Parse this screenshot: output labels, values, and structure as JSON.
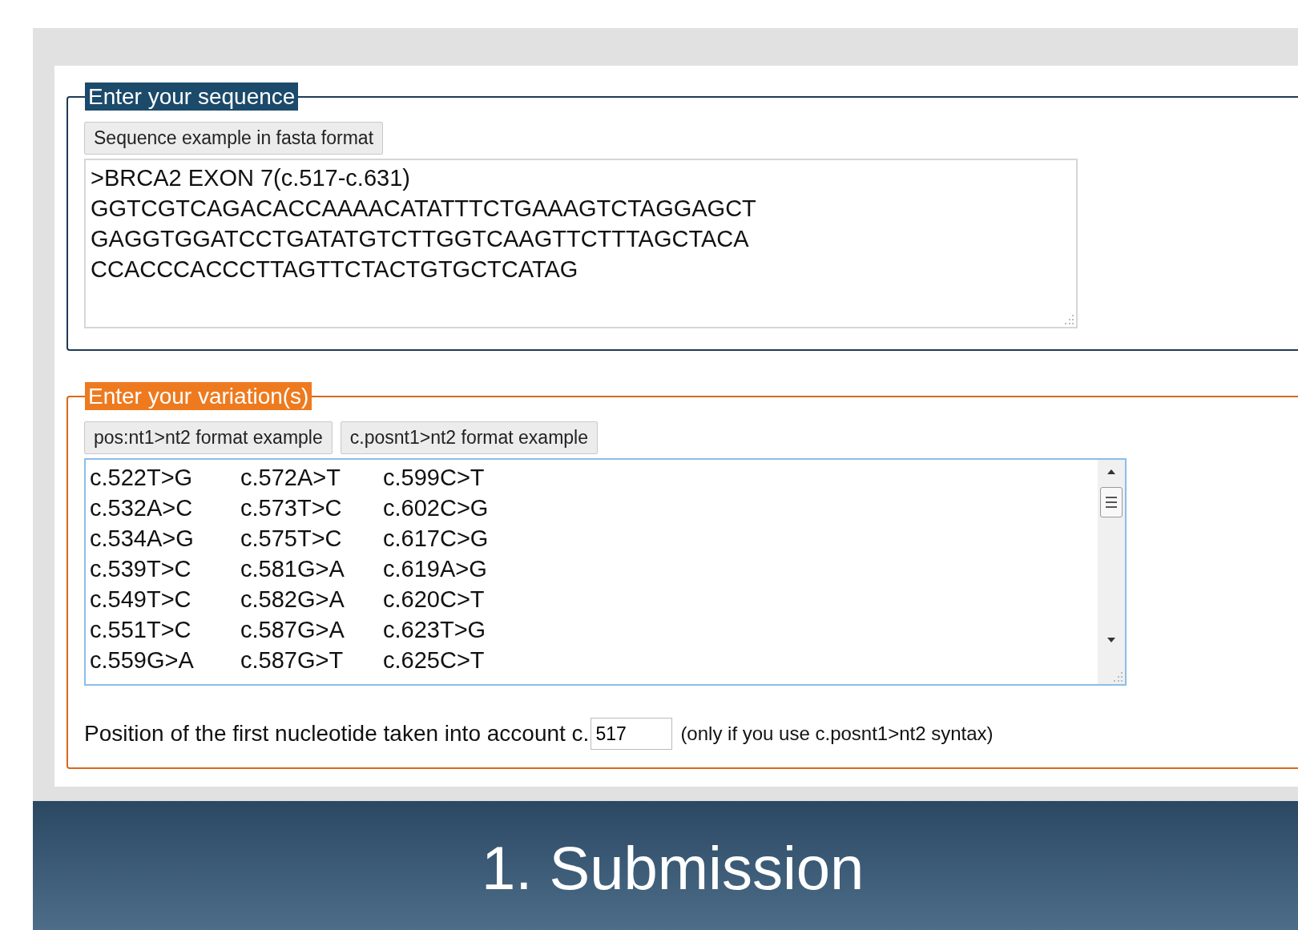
{
  "sequence_section": {
    "legend": "Enter your sequence",
    "example_button": "Sequence example in fasta format",
    "sequence_field": {
      "value": [
        ">BRCA2 EXON 7(c.517-c.631)",
        "GGTCGTCAGACACCAAAACATATTTCTGAAAGTCTAGGAGCT",
        "GAGGTGGATCCTGATATGTCTTGGTCAAGTTCTTTAGCTACA",
        "CCACCCACCCTTAGTTCTACTGTGCTCATAG"
      ]
    }
  },
  "variation_section": {
    "legend": "Enter your variation(s)",
    "example_buttons": [
      "pos:nt1>nt2 format example",
      "c.posnt1>nt2 format example"
    ],
    "variations_field": {
      "rows": [
        [
          "c.522T>G",
          "c.572A>T",
          "c.599C>T"
        ],
        [
          "c.532A>C",
          "c.573T>C",
          "c.602C>G"
        ],
        [
          "c.534A>G",
          "c.575T>C",
          "c.617C>G"
        ],
        [
          "c.539T>C",
          "c.581G>A",
          "c.619A>G"
        ],
        [
          "c.549T>C",
          "c.582G>A",
          "c.620C>T"
        ],
        [
          "c.551T>C",
          "c.587G>A",
          "c.623T>G"
        ],
        [
          "c.559G>A",
          "c.587G>T",
          "c.625C>T"
        ]
      ]
    },
    "position_label": "Position of the first nucleotide taken into account c.",
    "position_field": {
      "value": "517"
    },
    "position_hint": "(only if you use c.posnt1>nt2 syntax)"
  },
  "footer": {
    "title": "1. Submission"
  }
}
